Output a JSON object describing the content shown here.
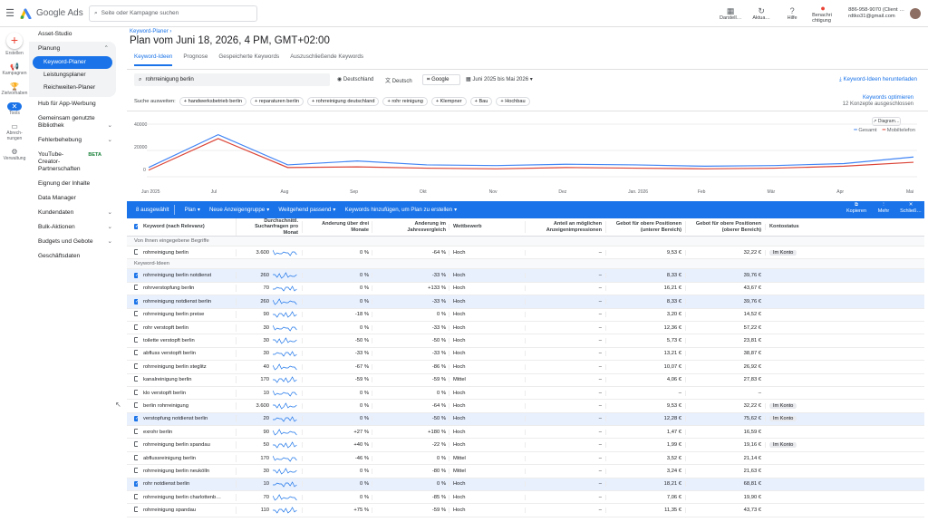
{
  "app": {
    "name": "Google Ads",
    "search_placeholder": "Seite oder Kampagne suchen"
  },
  "topbar": {
    "buttons": [
      {
        "label": "Darstell…",
        "icon": "chart-icon"
      },
      {
        "label": "Aktua…",
        "icon": "refresh-icon"
      },
      {
        "label": "Hilfe",
        "icon": "help-icon"
      },
      {
        "label": "Benachri chtigung",
        "icon": "bell-icon"
      }
    ],
    "account_id": "886-958-9070 (Client …",
    "account_email": "rdtko31@gmail.com"
  },
  "rail": {
    "create": "Erstellen",
    "items": [
      "Kampa­gnen",
      "Zielvor­haben",
      "Tools",
      "Abrech­nungen",
      "Verwal­tung"
    ]
  },
  "nav": {
    "asset_studio": "Asset-Studio",
    "planung": "Planung",
    "subs": [
      "Keyword-Planer",
      "Leistungsplaner",
      "Reichweiten-Planer"
    ],
    "items": [
      "Hub für App-Werbung",
      "Gemeinsam genutzte Bibliothek",
      "Fehlerbehebung",
      "YouTube-Creator-Partnerschaften",
      "Eignung der Inhalte",
      "Data Manager",
      "Kundendaten",
      "Bulk-Aktionen",
      "Budgets und Gebote",
      "Geschäftsdaten"
    ],
    "beta": "BETA"
  },
  "header": {
    "breadcrumb": "Keyword-Planer",
    "title": "Plan vom Juni 18, 2026, 4 PM, GMT+02:00",
    "tabs": [
      "Keyword-Ideen",
      "Prognose",
      "Gespeicherte Keywords",
      "Auszuschließende Keywords"
    ]
  },
  "filters": {
    "keyword": "rohrreinigung berlin",
    "location": "Deutschland",
    "language": "Deutsch",
    "network": "Google",
    "date": "Juni 2025 bis Mai 2026",
    "download": "Keyword-Ideen herunterladen",
    "suggest_label": "Suche ausweiten:",
    "suggestions": [
      "handwerksbetrieb berlin",
      "reparaturen berlin",
      "rohrreinigung deutschland",
      "rohr reinigung",
      "Klempner",
      "Bau",
      "Hochbau"
    ],
    "optimize": "Keywords optimieren",
    "excluded": "12 Konzepte ausgeschlossen",
    "diagram_btn": "Diagram…"
  },
  "chart_data": {
    "type": "line",
    "x": [
      "Jun 2025",
      "Jul",
      "Aug",
      "Sep",
      "Okt",
      "Nov",
      "Dez",
      "Jan. 2026",
      "Feb",
      "Mär",
      "Apr",
      "Mai"
    ],
    "series": [
      {
        "name": "Gesamt",
        "color": "#4285f4",
        "values": [
          7000,
          32000,
          9000,
          12000,
          9000,
          8500,
          9500,
          9000,
          8000,
          8500,
          10000,
          15000
        ]
      },
      {
        "name": "Mobiltelefon",
        "color": "#db4437",
        "values": [
          5000,
          29000,
          7000,
          7500,
          6500,
          6000,
          7000,
          6500,
          6000,
          6500,
          8000,
          11000
        ]
      }
    ],
    "yticks": [
      "40000",
      "20000",
      "0"
    ],
    "ylim": [
      0,
      40000
    ]
  },
  "actionbar": {
    "selected": "8 ausgewählt",
    "plan": "Plan",
    "newgroup": "Neue Anzeigengruppe",
    "match": "Weitgehend passend",
    "add": "Keywords hinzufügen, um Plan zu erstellen",
    "copy": "Kopieren",
    "more": "Mehr",
    "close": "Schließ…"
  },
  "table": {
    "headers": [
      "Keyword (nach Relevanz)",
      "Durchschnittl. Suchanfragen pro Monat",
      "Änderung über drei Monate",
      "Änderung im Jahresvergleich",
      "Wettbewerb",
      "Anteil an möglichen Anzeigenimpressionen",
      "Gebot für obere Positionen (unterer Bereich)",
      "Gebot für obere Positionen (oberer Bereich)",
      "Kontostatus"
    ],
    "group1": "Von Ihnen eingegebene Begriffe",
    "group2": "Keyword-Ideen",
    "rows": [
      {
        "kw": "rohrreinigung berlin",
        "vol": "3.600",
        "tr": "0 %",
        "yoy": "-64 %",
        "comp": "Hoch",
        "share": "–",
        "lo": "9,53 €",
        "hi": "32,22 €",
        "st": "Im Konto",
        "sel": false,
        "g": 1
      },
      {
        "kw": "rohrreinigung berlin notdienst",
        "vol": "260",
        "tr": "0 %",
        "yoy": "-33 %",
        "comp": "Hoch",
        "share": "–",
        "lo": "8,33 €",
        "hi": "39,76 €",
        "st": "",
        "sel": true
      },
      {
        "kw": "rohrverstopfung berlin",
        "vol": "70",
        "tr": "0 %",
        "yoy": "+133 %",
        "comp": "Hoch",
        "share": "–",
        "lo": "16,21 €",
        "hi": "43,67 €",
        "st": "",
        "sel": false
      },
      {
        "kw": "rohrreinigung notdienst berlin",
        "vol": "260",
        "tr": "0 %",
        "yoy": "-33 %",
        "comp": "Hoch",
        "share": "–",
        "lo": "8,33 €",
        "hi": "39,76 €",
        "st": "",
        "sel": true
      },
      {
        "kw": "rohrreinigung berlin preise",
        "vol": "90",
        "tr": "-18 %",
        "yoy": "0 %",
        "comp": "Hoch",
        "share": "–",
        "lo": "3,20 €",
        "hi": "14,52 €",
        "st": "",
        "sel": false
      },
      {
        "kw": "rohr verstopft berlin",
        "vol": "30",
        "tr": "0 %",
        "yoy": "-33 %",
        "comp": "Hoch",
        "share": "–",
        "lo": "12,36 €",
        "hi": "57,22 €",
        "st": "",
        "sel": false
      },
      {
        "kw": "toilette verstopft berlin",
        "vol": "30",
        "tr": "-50 %",
        "yoy": "-50 %",
        "comp": "Hoch",
        "share": "–",
        "lo": "5,73 €",
        "hi": "23,81 €",
        "st": "",
        "sel": false
      },
      {
        "kw": "abfluss verstopft berlin",
        "vol": "30",
        "tr": "-33 %",
        "yoy": "-33 %",
        "comp": "Hoch",
        "share": "–",
        "lo": "13,21 €",
        "hi": "38,87 €",
        "st": "",
        "sel": false
      },
      {
        "kw": "rohrreinigung berlin steglitz",
        "vol": "40",
        "tr": "-67 %",
        "yoy": "-86 %",
        "comp": "Hoch",
        "share": "–",
        "lo": "10,07 €",
        "hi": "26,92 €",
        "st": "",
        "sel": false
      },
      {
        "kw": "kanalreinigung berlin",
        "vol": "170",
        "tr": "-59 %",
        "yoy": "-59 %",
        "comp": "Mittel",
        "share": "–",
        "lo": "4,06 €",
        "hi": "27,83 €",
        "st": "",
        "sel": false
      },
      {
        "kw": "klo verstopft berlin",
        "vol": "10",
        "tr": "0 %",
        "yoy": "0 %",
        "comp": "Hoch",
        "share": "–",
        "lo": "–",
        "hi": "–",
        "st": "",
        "sel": false
      },
      {
        "kw": "berlin rohrreinigung",
        "vol": "3.600",
        "tr": "0 %",
        "yoy": "-64 %",
        "comp": "Hoch",
        "share": "–",
        "lo": "9,53 €",
        "hi": "32,22 €",
        "st": "Im Konto",
        "sel": false
      },
      {
        "kw": "verstopfung notdienst berlin",
        "vol": "20",
        "tr": "0 %",
        "yoy": "-50 %",
        "comp": "Hoch",
        "share": "–",
        "lo": "12,28 €",
        "hi": "75,62 €",
        "st": "Im Konto",
        "sel": true
      },
      {
        "kw": "exrohr berlin",
        "vol": "90",
        "tr": "+27 %",
        "yoy": "+180 %",
        "comp": "Hoch",
        "share": "–",
        "lo": "1,47 €",
        "hi": "16,59 €",
        "st": "",
        "sel": false
      },
      {
        "kw": "rohrreinigung berlin spandau",
        "vol": "50",
        "tr": "+40 %",
        "yoy": "-22 %",
        "comp": "Hoch",
        "share": "–",
        "lo": "1,99 €",
        "hi": "19,16 €",
        "st": "Im Konto",
        "sel": false
      },
      {
        "kw": "abflussreinigung berlin",
        "vol": "170",
        "tr": "-46 %",
        "yoy": "0 %",
        "comp": "Mittel",
        "share": "–",
        "lo": "3,52 €",
        "hi": "21,14 €",
        "st": "",
        "sel": false
      },
      {
        "kw": "rohrreinigung berlin neukölln",
        "vol": "30",
        "tr": "0 %",
        "yoy": "-80 %",
        "comp": "Mittel",
        "share": "–",
        "lo": "3,24 €",
        "hi": "21,63 €",
        "st": "",
        "sel": false
      },
      {
        "kw": "rohr notdienst berlin",
        "vol": "10",
        "tr": "0 %",
        "yoy": "0 %",
        "comp": "Hoch",
        "share": "–",
        "lo": "18,21 €",
        "hi": "68,81 €",
        "st": "",
        "sel": true
      },
      {
        "kw": "rohrreinigung berlin charlottenb…",
        "vol": "70",
        "tr": "0 %",
        "yoy": "-85 %",
        "comp": "Hoch",
        "share": "–",
        "lo": "7,06 €",
        "hi": "19,90 €",
        "st": "",
        "sel": false
      },
      {
        "kw": "rohrreinigung spandau",
        "vol": "110",
        "tr": "+75 %",
        "yoy": "-59 %",
        "comp": "Hoch",
        "share": "–",
        "lo": "11,35 €",
        "hi": "43,73 €",
        "st": "",
        "sel": false
      }
    ]
  }
}
